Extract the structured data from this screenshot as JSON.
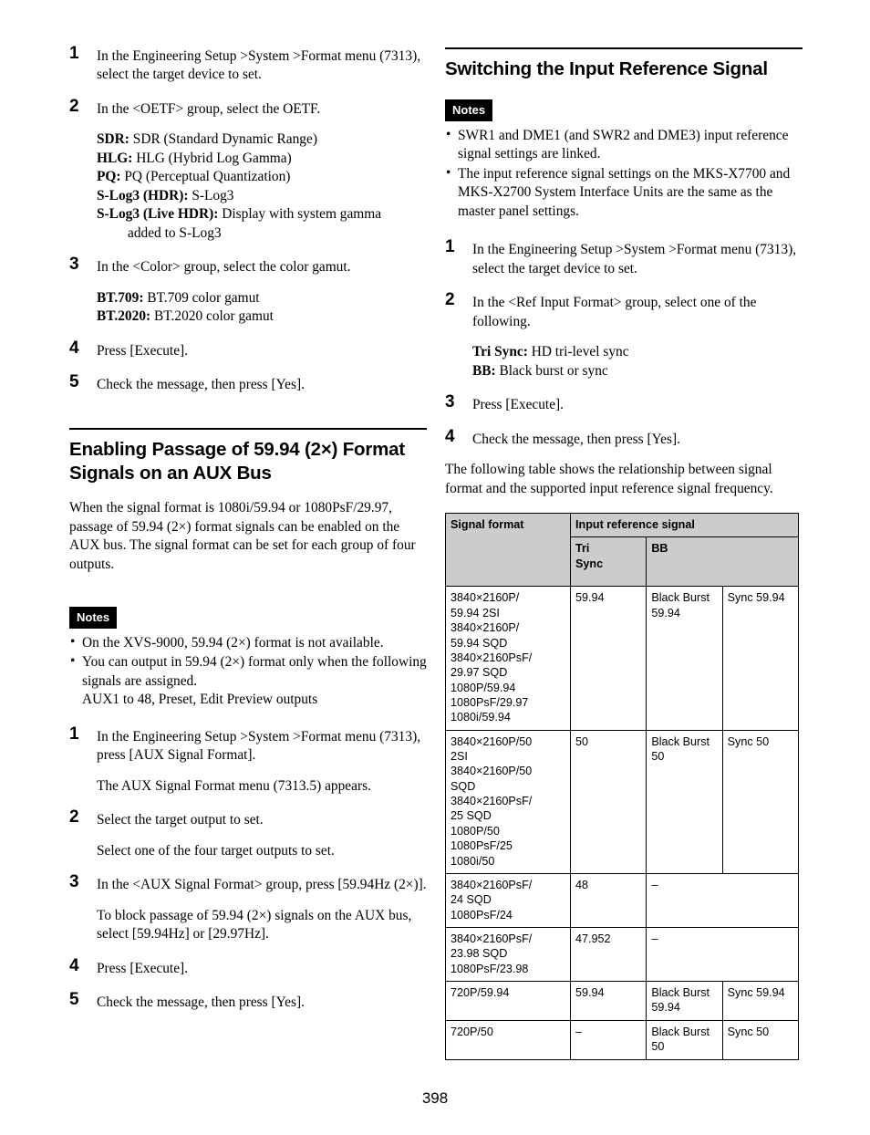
{
  "page": {
    "number": "398"
  },
  "left_column": {
    "steps_top": [
      {
        "num": "1",
        "text": "In the Engineering Setup >System >Format menu (7313), select the target device to set."
      },
      {
        "num": "2",
        "text": "In the <OETF> group, select the OETF."
      }
    ],
    "oetf_definitions": [
      {
        "term": "SDR:",
        "desc": " SDR (Standard Dynamic Range)"
      },
      {
        "term": "HLG:",
        "desc": " HLG (Hybrid Log Gamma)"
      },
      {
        "term": "PQ:",
        "desc": " PQ (Perceptual Quantization)"
      },
      {
        "term": "S-Log3 (HDR):",
        "desc": " S-Log3"
      },
      {
        "term": "S-Log3 (Live HDR):",
        "desc": " Display with system gamma",
        "cont": "added to S-Log3"
      }
    ],
    "step3": {
      "num": "3",
      "text": "In the <Color> group, select the color gamut."
    },
    "color_definitions": [
      {
        "term": "BT.709:",
        "desc": " BT.709 color gamut"
      },
      {
        "term": "BT.2020:",
        "desc": " BT.2020 color gamut"
      }
    ],
    "step4": {
      "num": "4",
      "text": "Press [Execute]."
    },
    "step5": {
      "num": "5",
      "text": "Check the message, then press [Yes]."
    },
    "heading": "Enabling Passage of 59.94 (2×) Format Signals on an AUX Bus",
    "intro": "When the signal format is 1080i/59.94 or 1080PsF/29.97, passage of 59.94 (2×) format signals can be enabled on the AUX bus. The signal format can be set for each group of four outputs.",
    "notes_label": "Notes",
    "notes": [
      {
        "text": "On the XVS-9000, 59.94 (2×) format is not available."
      },
      {
        "text": "You can output in 59.94 (2×) format only when the following signals are assigned.",
        "sub": "AUX1 to 48, Preset, Edit Preview outputs"
      }
    ],
    "aux_steps": [
      {
        "num": "1",
        "text": "In the Engineering Setup >System >Format menu (7313), press [AUX Signal Format].",
        "extra": "The AUX Signal Format menu (7313.5) appears."
      },
      {
        "num": "2",
        "text": "Select the target output to set.",
        "extra": "Select one of the four target outputs to set."
      },
      {
        "num": "3",
        "text": "In the <AUX Signal Format> group, press [59.94Hz (2×)].",
        "extra": "To block passage of 59.94 (2×) signals on the AUX bus, select [59.94Hz] or [29.97Hz]."
      },
      {
        "num": "4",
        "text": "Press [Execute]."
      },
      {
        "num": "5",
        "text": "Check the message, then press [Yes]."
      }
    ]
  },
  "right_column": {
    "heading": "Switching the Input Reference Signal",
    "notes_label": "Notes",
    "notes": [
      {
        "text": "SWR1 and DME1 (and SWR2 and DME3) input reference signal settings are linked."
      },
      {
        "text": "The input reference signal settings on the MKS-X7700 and MKS-X2700 System Interface Units are the same as the master panel settings."
      }
    ],
    "steps": [
      {
        "num": "1",
        "text": "In the Engineering Setup >System >Format menu (7313), select the target device to set."
      },
      {
        "num": "2",
        "text": "In the <Ref Input Format> group, select one of the following."
      }
    ],
    "ref_definitions": [
      {
        "term": "Tri Sync:",
        "desc": " HD tri-level sync"
      },
      {
        "term": "BB:",
        "desc": " Black burst or sync"
      }
    ],
    "step3": {
      "num": "3",
      "text": "Press [Execute]."
    },
    "step4": {
      "num": "4",
      "text": "Check the message, then press [Yes]."
    },
    "table_intro": "The following table shows the relationship between signal format and the supported input reference signal frequency.",
    "table": {
      "header": {
        "signal_format": "Signal format",
        "input_reference_signal": "Input reference signal",
        "tri_sync": "Tri\nSync",
        "tri_sync_line1": "Tri",
        "tri_sync_line2": "Sync",
        "bb": "BB"
      },
      "rows": [
        {
          "format_lines": [
            "3840×2160P/",
            "59.94 2SI",
            "3840×2160P/",
            "59.94 SQD",
            "3840×2160PsF/",
            "29.97 SQD",
            "1080P/59.94",
            "1080PsF/29.97",
            "1080i/59.94"
          ],
          "tri_sync": "59.94",
          "bb_lines": [
            "Black Burst",
            "59.94"
          ],
          "sync": "Sync 59.94",
          "merged": false
        },
        {
          "format_lines": [
            "3840×2160P/50",
            "2SI",
            "3840×2160P/50",
            "SQD",
            "3840×2160PsF/",
            "25 SQD",
            "1080P/50",
            "1080PsF/25",
            "1080i/50"
          ],
          "tri_sync": "50",
          "bb_lines": [
            "Black Burst 50"
          ],
          "sync": "Sync 50",
          "merged": false
        },
        {
          "format_lines": [
            "3840×2160PsF/",
            "24 SQD",
            "1080PsF/24"
          ],
          "tri_sync": "48",
          "bb_lines": [
            "–"
          ],
          "sync": "",
          "merged": true
        },
        {
          "format_lines": [
            "3840×2160PsF/",
            "23.98 SQD",
            "1080PsF/23.98"
          ],
          "tri_sync": "47.952",
          "bb_lines": [
            "–"
          ],
          "sync": "",
          "merged": true
        },
        {
          "format_lines": [
            "720P/59.94"
          ],
          "tri_sync": "59.94",
          "bb_lines": [
            "Black Burst",
            "59.94"
          ],
          "sync": "Sync 59.94",
          "merged": false
        },
        {
          "format_lines": [
            "720P/50"
          ],
          "tri_sync": "–",
          "bb_lines": [
            "Black Burst 50"
          ],
          "sync": "Sync 50",
          "merged": false
        }
      ]
    }
  }
}
